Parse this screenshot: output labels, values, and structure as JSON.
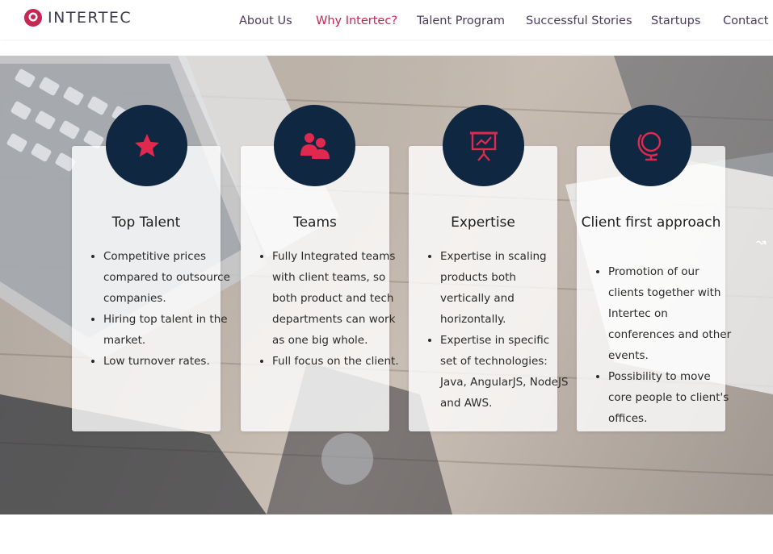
{
  "header": {
    "logo_text": "INTERTEC",
    "nav": [
      {
        "label": "About Us",
        "active": false
      },
      {
        "label": "Why Intertec?",
        "active": true
      },
      {
        "label": "Talent Program",
        "active": false
      },
      {
        "label": "Successful Stories",
        "active": false
      },
      {
        "label": "Startups",
        "active": false
      },
      {
        "label": "Contact",
        "active": false
      }
    ]
  },
  "colors": {
    "accent": "#c72552",
    "icon_bg": "#0f2740",
    "nav_text": "#4a3a5c"
  },
  "cards": [
    {
      "icon": "star-icon",
      "title": "Top Talent",
      "bullets": [
        "Competitive prices compared to outsource companies.",
        "Hiring top talent in the market.",
        "Low turnover rates."
      ]
    },
    {
      "icon": "users-icon",
      "title": "Teams",
      "bullets": [
        "Fully Integrated teams with client teams, so both product and tech departments can work as one big whole.",
        "Full focus on the client."
      ]
    },
    {
      "icon": "presentation-chart-icon",
      "title": "Expertise",
      "bullets": [
        "Expertise in scaling products both vertically and horizontally.",
        "Expertise in specific set of technologies: Java, AngularJS, NodeJS and AWS."
      ]
    },
    {
      "icon": "globe-icon",
      "title": "Client first approach",
      "bullets": [
        "Promotion of our clients together with Intertec on conferences and other events.",
        "Possibility to move core people to client's offices."
      ]
    }
  ]
}
